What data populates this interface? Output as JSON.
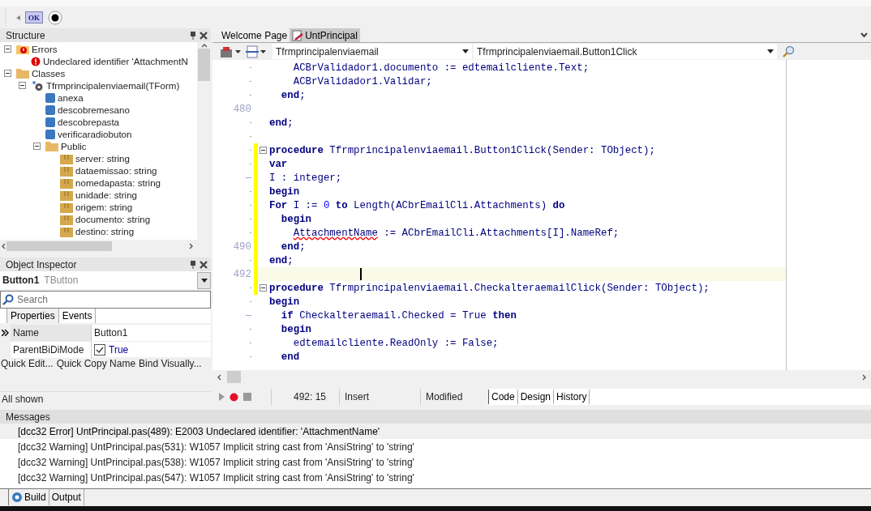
{
  "toolbar": {
    "ok_button": "OK"
  },
  "structure": {
    "title": "Structure",
    "tree": [
      {
        "label": "Errors",
        "kind": "errors",
        "expanded": true,
        "children": [
          {
            "label": "Undeclared identifier 'AttachmentN",
            "kind": "error"
          }
        ]
      },
      {
        "label": "Classes",
        "kind": "folder",
        "expanded": true,
        "children": [
          {
            "label": "Tfrmprincipalenviaemail(TForm)",
            "kind": "class",
            "expanded": true,
            "children": [
              {
                "label": "anexa",
                "kind": "method"
              },
              {
                "label": "descobremesano",
                "kind": "method"
              },
              {
                "label": "descobrepasta",
                "kind": "method"
              },
              {
                "label": "verificaradiobuton",
                "kind": "method"
              },
              {
                "label": "Public",
                "kind": "folder",
                "expanded": true,
                "children": [
                  {
                    "label": "server: string",
                    "kind": "field"
                  },
                  {
                    "label": "dataemissao: string",
                    "kind": "field"
                  },
                  {
                    "label": "nomedapasta: string",
                    "kind": "field"
                  },
                  {
                    "label": "unidade: string",
                    "kind": "field"
                  },
                  {
                    "label": "origem: string",
                    "kind": "field"
                  },
                  {
                    "label": "documento: string",
                    "kind": "field"
                  },
                  {
                    "label": "destino: string",
                    "kind": "field"
                  }
                ]
              }
            ]
          }
        ]
      }
    ]
  },
  "object_inspector": {
    "title": "Object Inspector",
    "component": "Button1",
    "component_type": "TButton",
    "search": {
      "placeholder": "Search"
    },
    "tabs": [
      {
        "label": "Properties",
        "selected": true
      },
      {
        "label": "Events",
        "selected": false
      }
    ],
    "properties": [
      {
        "name": "Name",
        "value": "Button1",
        "kind": "text",
        "selected": true
      },
      {
        "name": "ParentBiDiMode",
        "value": "True",
        "kind": "check",
        "checked": true,
        "selected": false
      }
    ],
    "links": [
      "Quick Edit...",
      "Quick Copy Name",
      "Bind Visually..."
    ],
    "status": "All shown"
  },
  "editor": {
    "tabs": [
      {
        "label": "Welcome Page",
        "selected": false
      },
      {
        "label": "UntPrincipal",
        "selected": true
      }
    ],
    "class_combo": "Tfrmprincipalenviaemail",
    "method_combo": "Tfrmprincipalenviaemail.Button1Click",
    "lines": [
      {
        "kind": "dot",
        "tokens": [
          {
            "kind": "plain",
            "t": "    ACBrValidador1.documento := edtemailcliente.Text;"
          }
        ]
      },
      {
        "kind": "dot",
        "tokens": [
          {
            "kind": "plain",
            "t": "    ACBrValidador1.Validar;"
          }
        ]
      },
      {
        "kind": "dot",
        "tokens": [
          {
            "kind": "keyword",
            "t": "  end"
          },
          {
            "kind": "plain",
            "t": ";"
          }
        ]
      },
      {
        "kind": "numbered",
        "number": "480"
      },
      {
        "kind": "dot",
        "tokens": [
          {
            "kind": "keyword",
            "t": "end"
          },
          {
            "kind": "plain",
            "t": ";"
          }
        ]
      },
      {
        "kind": "dot"
      },
      {
        "kind": "dot",
        "changed": true,
        "fold": true,
        "tokens": [
          {
            "kind": "keyword",
            "t": "procedure"
          },
          {
            "kind": "plain",
            "t": " Tfrmprincipalenviaemail.Button1Click(Sender: TObject);"
          }
        ]
      },
      {
        "kind": "dot",
        "changed": true,
        "tokens": [
          {
            "kind": "keyword",
            "t": "var"
          }
        ]
      },
      {
        "kind": "dash",
        "changed": true,
        "tokens": [
          {
            "kind": "plain",
            "t": "I : integer;"
          }
        ]
      },
      {
        "kind": "dot",
        "changed": true,
        "tokens": [
          {
            "kind": "keyword",
            "t": "begin"
          }
        ]
      },
      {
        "kind": "dot",
        "changed": true,
        "tokens": [
          {
            "kind": "keyword",
            "t": "For"
          },
          {
            "kind": "plain",
            "t": " I := "
          },
          {
            "kind": "number",
            "t": "0"
          },
          {
            "kind": "keyword",
            "t": " to"
          },
          {
            "kind": "plain",
            "t": " Length(ACbrEmailCli.Attachments) "
          },
          {
            "kind": "keyword",
            "t": "do"
          }
        ]
      },
      {
        "kind": "dot",
        "changed": true,
        "tokens": [
          {
            "kind": "keyword",
            "t": "  begin"
          }
        ]
      },
      {
        "kind": "dot",
        "changed": true,
        "tokens": [
          {
            "kind": "error",
            "t": "    AttachmentName"
          },
          {
            "kind": "plain",
            "t": " := ACbrEmailCli.Attachments[I].NameRef;"
          }
        ]
      },
      {
        "kind": "numbered",
        "number": "490",
        "changed": true,
        "tokens": [
          {
            "kind": "keyword",
            "t": "  end"
          },
          {
            "kind": "plain",
            "t": ";"
          }
        ]
      },
      {
        "kind": "dot",
        "changed": true,
        "tokens": [
          {
            "kind": "keyword",
            "t": "end"
          },
          {
            "kind": "plain",
            "t": ";"
          }
        ]
      },
      {
        "kind": "numbered",
        "number": "492",
        "changed": true,
        "current": true
      },
      {
        "kind": "dot",
        "changed": true,
        "fold": true,
        "tokens": [
          {
            "kind": "keyword",
            "t": "procedure"
          },
          {
            "kind": "plain",
            "t": " Tfrmprincipalenviaemail.CheckalteraemailClick(Sender: TObject);"
          }
        ]
      },
      {
        "kind": "dot",
        "tokens": [
          {
            "kind": "keyword",
            "t": "begin"
          }
        ]
      },
      {
        "kind": "dash",
        "tokens": [
          {
            "kind": "keyword",
            "t": "  if"
          },
          {
            "kind": "plain",
            "t": " Checkalteraemail.Checked = True "
          },
          {
            "kind": "keyword",
            "t": "then"
          }
        ]
      },
      {
        "kind": "dot",
        "tokens": [
          {
            "kind": "keyword",
            "t": "  begin"
          }
        ]
      },
      {
        "kind": "dot",
        "tokens": [
          {
            "kind": "plain",
            "t": "    edtemailcliente.ReadOnly := False;"
          }
        ]
      },
      {
        "kind": "dot",
        "tokens": [
          {
            "kind": "keyword",
            "t": "  end"
          }
        ]
      }
    ],
    "status": {
      "position": "492: 15",
      "mode": "Insert",
      "state": "Modified"
    },
    "view_tabs": [
      {
        "label": "Code",
        "selected": true
      },
      {
        "label": "Design",
        "selected": false
      },
      {
        "label": "History",
        "selected": false
      }
    ]
  },
  "messages": {
    "title": "Messages",
    "items": [
      {
        "text": "[dcc32 Error] UntPrincipal.pas(489): E2003 Undeclared identifier: 'AttachmentName'",
        "kind": "error",
        "selected": true
      },
      {
        "text": "[dcc32 Warning] UntPrincipal.pas(531): W1057 Implicit string cast from 'AnsiString' to 'string'",
        "kind": "warning",
        "selected": false
      },
      {
        "text": "[dcc32 Warning] UntPrincipal.pas(538): W1057 Implicit string cast from 'AnsiString' to 'string'",
        "kind": "warning",
        "selected": false
      },
      {
        "text": "[dcc32 Warning] UntPrincipal.pas(547): W1057 Implicit string cast from 'AnsiString' to 'string'",
        "kind": "warning",
        "selected": false
      }
    ],
    "tabs": [
      {
        "label": "Build",
        "selected": true
      },
      {
        "label": "Output",
        "selected": false
      }
    ]
  }
}
